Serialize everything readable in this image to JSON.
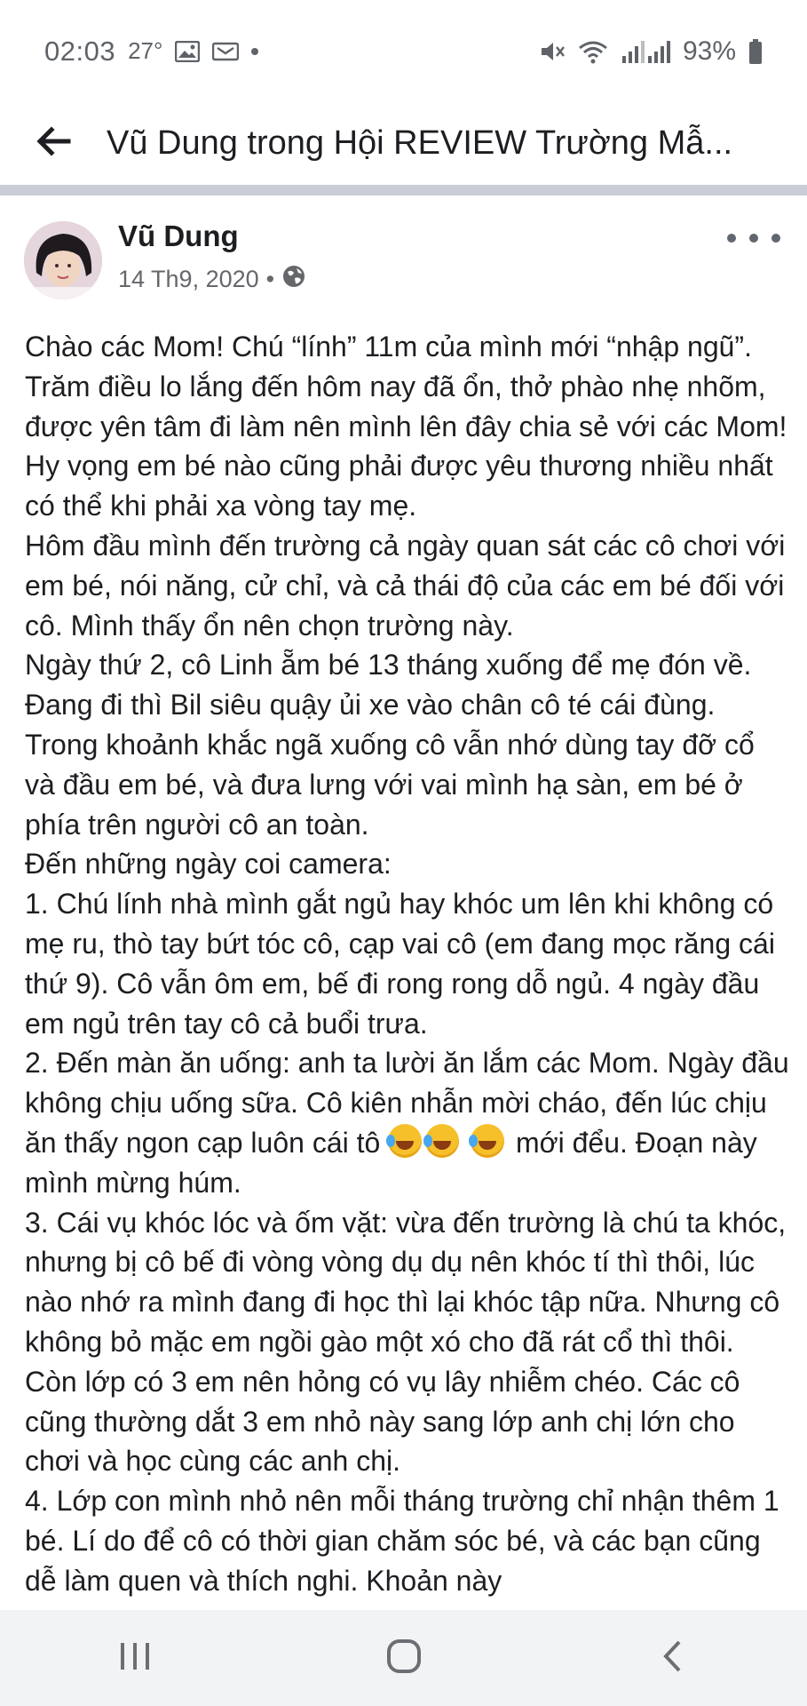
{
  "status_bar": {
    "time": "02:03",
    "temperature": "27°",
    "battery": "93%",
    "icons": [
      "image-icon",
      "voicemail-icon",
      "dot-icon",
      "mute-icon",
      "wifi-icon",
      "signal-icon",
      "battery-icon"
    ]
  },
  "header": {
    "title": "Vũ Dung trong Hội REVIEW Trường Mẫ...",
    "back_icon": "arrow-left-icon"
  },
  "post": {
    "author": "Vũ Dung",
    "date": "14 Th9, 2020",
    "separator": "•",
    "privacy_icon": "globe-icon",
    "more_icon": "more-horizontal-icon",
    "paragraphs": [
      "Chào các Mom! Chú “lính” 11m của mình mới “nhập ngũ”. Trăm điều lo lắng đến hôm nay đã ổn, thở phào nhẹ nhõm, được yên tâm đi làm nên mình lên đây chia sẻ với các Mom! Hy vọng em bé nào cũng phải được yêu thương nhiều nhất có thể khi phải xa vòng tay mẹ.",
      "Hôm đầu mình đến trường cả ngày quan sát các cô chơi với em bé, nói năng, cử chỉ, và cả thái độ của các em bé đối với cô. Mình thấy ổn nên chọn trường này.",
      "Ngày thứ 2, cô Linh ẵm bé 13 tháng xuống để mẹ đón về. Đang đi thì Bil siêu quậy ủi xe vào chân cô té cái đùng. Trong khoảnh khắc ngã xuống cô vẫn nhớ dùng tay đỡ cổ và đầu em bé, và đưa lưng với vai mình hạ sàn, em bé ở phía trên người cô an toàn.",
      "Đến những ngày coi camera:",
      "1. Chú lính nhà mình gắt ngủ hay khóc um lên khi không có mẹ ru, thò tay bứt tóc cô, cạp vai cô (em đang mọc răng cái thứ 9). Cô vẫn ôm em, bế đi rong rong dỗ ngủ. 4 ngày đầu em ngủ trên tay cô cả buổi trưa."
    ],
    "paragraph_6_before_emoji": "2. Đến màn ăn uống: anh ta lười ăn lắm các Mom. Ngày đầu không chịu uống sữa. Cô kiên nhẫn mời cháo, đến lúc chịu ăn thấy ngon cạp luôn cái tô ",
    "paragraph_6_after_emoji": " mới đểu. Đoạn này mình mừng húm.",
    "emoji_name": "rolling-on-floor-laughing-emoji",
    "paragraphs_after": [
      "3. Cái vụ khóc lóc và ốm vặt: vừa đến trường là chú ta khóc, nhưng bị cô bế đi vòng vòng dụ dụ nên khóc tí thì thôi, lúc nào nhớ ra mình đang đi học thì lại khóc tập nữa. Nhưng cô không bỏ mặc em ngồi gào một xó cho đã rát cổ thì thôi. Còn lớp có 3 em nên hỏng có vụ lây nhiễm chéo. Các cô cũng thường dắt 3 em nhỏ này sang lớp anh chị lớn cho chơi và học cùng các anh chị.",
      "4. Lớp con mình nhỏ nên mỗi tháng trường chỉ nhận thêm 1 bé. Lí do để cô có thời gian chăm sóc bé, và các bạn cũng dễ làm quen và thích nghi. Khoản này"
    ]
  },
  "nav_bar": {
    "recents_icon": "recents-icon",
    "home_icon": "home-icon",
    "back_icon": "back-chevron-icon"
  }
}
